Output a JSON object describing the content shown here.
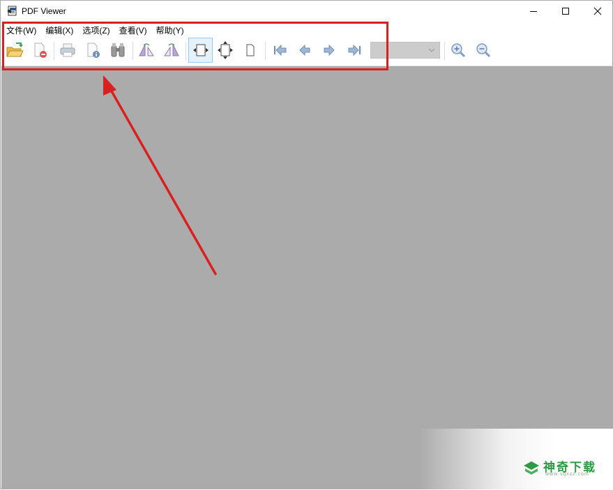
{
  "window": {
    "title": "PDF Viewer",
    "controls": [
      "minimize",
      "maximize",
      "close"
    ]
  },
  "menu": {
    "items": [
      {
        "label": "文件(W)"
      },
      {
        "label": "编辑(X)"
      },
      {
        "label": "选项(Z)"
      },
      {
        "label": "查看(V)"
      },
      {
        "label": "帮助(Y)"
      }
    ]
  },
  "toolbar": {
    "buttons": [
      {
        "icon": "open-folder-icon"
      },
      {
        "icon": "close-document-icon"
      },
      {
        "icon": "print-icon"
      },
      {
        "icon": "document-info-icon"
      },
      {
        "icon": "binoculars-icon"
      },
      {
        "icon": "rotate-left-icon"
      },
      {
        "icon": "rotate-right-icon"
      },
      {
        "icon": "fit-width-icon",
        "active": true
      },
      {
        "icon": "fit-page-icon"
      },
      {
        "icon": "actual-size-icon"
      },
      {
        "icon": "first-page-icon"
      },
      {
        "icon": "previous-page-icon"
      },
      {
        "icon": "next-page-icon"
      },
      {
        "icon": "last-page-icon"
      },
      {
        "icon": "zoom-in-icon"
      },
      {
        "icon": "zoom-out-icon"
      }
    ],
    "page_select": {
      "value": ""
    }
  },
  "colors": {
    "viewer_background": "#ababab",
    "annotation_red": "#d9201f",
    "active_button": "#e5f1fb",
    "watermark_green": "#2f9a45"
  },
  "watermark": {
    "brand": "神奇下载",
    "url": "www.sqxzz.com"
  }
}
